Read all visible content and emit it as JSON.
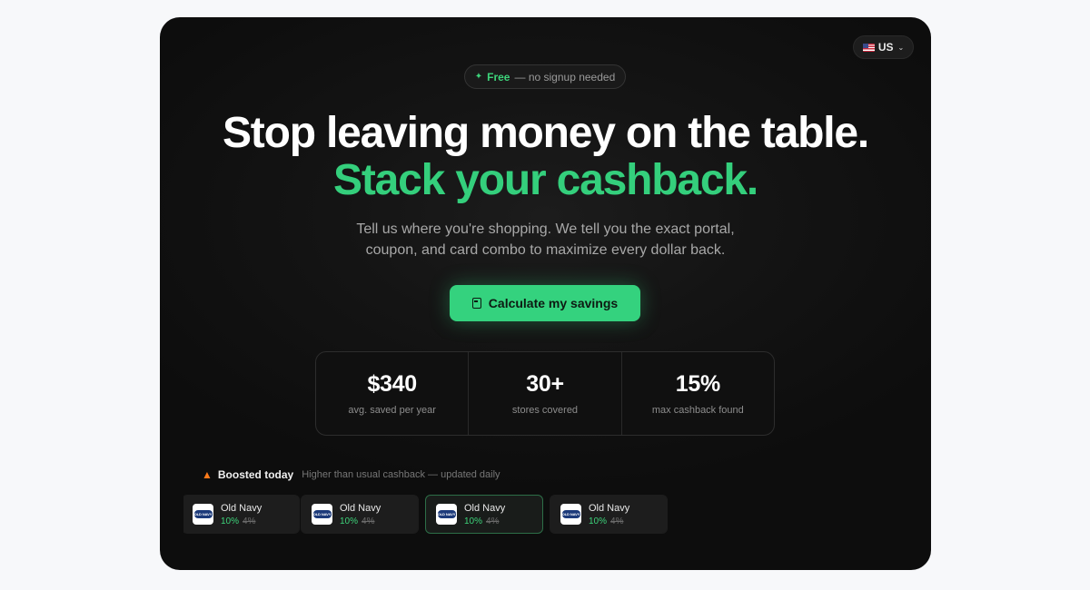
{
  "country": {
    "code": "US",
    "flag_icon": "us-flag-icon"
  },
  "badge": {
    "free": "Free",
    "rest": "— no signup needed"
  },
  "hero": {
    "line1": "Stop leaving money on the table.",
    "line2": "Stack your cashback.",
    "subtitle": "Tell us where you're shopping. We tell you the exact portal, coupon, and card combo to maximize every dollar back."
  },
  "cta": {
    "label": "Calculate my savings",
    "icon": "calculator-icon"
  },
  "stats": [
    {
      "value": "$340",
      "label": "avg. saved per year"
    },
    {
      "value": "30+",
      "label": "stores covered"
    },
    {
      "value": "15%",
      "label": "max cashback found"
    }
  ],
  "boosted": {
    "title": "Boosted today",
    "note": "Higher than usual cashback — updated daily",
    "deals": [
      {
        "name": "Old Navy",
        "new_rate": "10%",
        "old_rate": "4%",
        "logo_text": "OLD NAVY"
      },
      {
        "name": "Old Navy",
        "new_rate": "10%",
        "old_rate": "4%",
        "logo_text": "OLD NAVY"
      },
      {
        "name": "Old Navy",
        "new_rate": "10%",
        "old_rate": "4%",
        "logo_text": "OLD NAVY"
      },
      {
        "name": "Old Navy",
        "new_rate": "10%",
        "old_rate": "4%",
        "logo_text": "OLD NAVY"
      }
    ]
  },
  "colors": {
    "accent": "#34d27e",
    "background": "#0d0d0d",
    "page": "#f7f8fa"
  }
}
